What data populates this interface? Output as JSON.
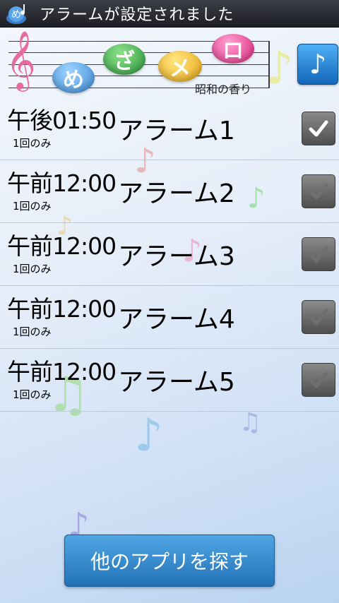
{
  "titlebar": {
    "title": "アラームが設定されました",
    "icon": "app-logo-icon"
  },
  "header": {
    "logo_chars": [
      "め",
      "ざ",
      "メ",
      "ロ"
    ],
    "subtitle": "昭和の香り",
    "music_button_icon": "music-note-icon"
  },
  "alarms": [
    {
      "time": "午後01:50",
      "repeat": "1回のみ",
      "name": "アラーム1",
      "enabled": true
    },
    {
      "time": "午前12:00",
      "repeat": "1回のみ",
      "name": "アラーム2",
      "enabled": false
    },
    {
      "time": "午前12:00",
      "repeat": "1回のみ",
      "name": "アラーム3",
      "enabled": false
    },
    {
      "time": "午前12:00",
      "repeat": "1回のみ",
      "name": "アラーム4",
      "enabled": false
    },
    {
      "time": "午前12:00",
      "repeat": "1回のみ",
      "name": "アラーム5",
      "enabled": false
    }
  ],
  "footer": {
    "find_apps_label": "他のアプリを探す"
  },
  "colors": {
    "titlebar": "#1d1f24",
    "accent_button": "#2372b8",
    "checkbox": "#4f4f4f"
  }
}
